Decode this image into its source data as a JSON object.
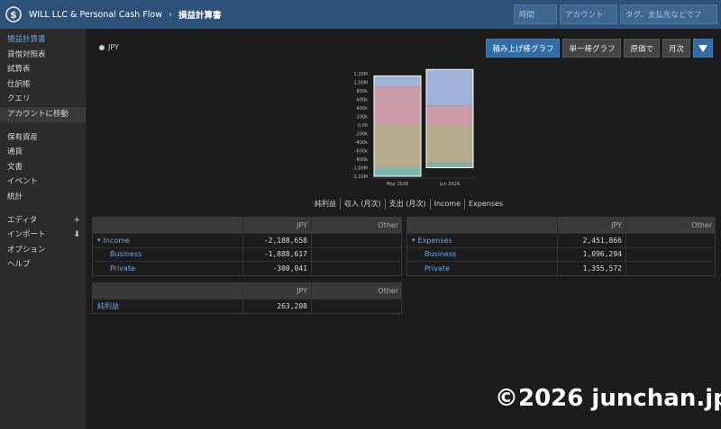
{
  "header": {
    "app_title": "WILL LLC & Personal Cash Flow",
    "separator": "›",
    "page": "損益計算書",
    "inputs": [
      {
        "placeholder": "時間"
      },
      {
        "placeholder": "アカウント"
      },
      {
        "placeholder": "タグ、支払先などでフ"
      }
    ]
  },
  "sidebar": {
    "items": [
      {
        "label": "損益計算書"
      },
      {
        "label": "貸借対照表"
      },
      {
        "label": "試算表"
      },
      {
        "label": "仕訳帳"
      },
      {
        "label": "クエリ"
      },
      {
        "label": "アカウントに移動"
      },
      {
        "label": "保有資産"
      },
      {
        "label": "通貨"
      },
      {
        "label": "文書"
      },
      {
        "label": "イベント"
      },
      {
        "label": "統計"
      },
      {
        "label": "エディタ",
        "action": "+"
      },
      {
        "label": "インポート",
        "action": "⬇"
      },
      {
        "label": "オプション"
      },
      {
        "label": "ヘルプ"
      }
    ]
  },
  "legend": {
    "label": "JPY"
  },
  "toolbar": {
    "stacked": "積み上げ棒グラフ",
    "single": "単一棒グラフ",
    "at_value": "原価で",
    "monthly": "月次"
  },
  "chart_data": {
    "type": "bar",
    "stacked": true,
    "categories": [
      "May 2026",
      "Jun 2026"
    ],
    "y_ticks": [
      "1.20M",
      "1.00M",
      "800k",
      "600k",
      "400k",
      "200k",
      "0.00",
      "-200k",
      "-400k",
      "-600k",
      "-800k",
      "-1.00M",
      "-1.20M"
    ],
    "ylim": [
      -1200000,
      1200000
    ],
    "series": [
      {
        "color": "#c99ba6",
        "values": [
          900000,
          450000
        ]
      },
      {
        "color": "#9fb3d8",
        "values": [
          250000,
          850000
        ]
      },
      {
        "color": "#b3ab8a",
        "values": [
          -1000000,
          -900000
        ]
      },
      {
        "color": "#7db8ae",
        "values": [
          -200000,
          -100000
        ]
      }
    ]
  },
  "tabs": [
    "純利益",
    "収入 (月次)",
    "支出 (月次)",
    "Income",
    "Expenses"
  ],
  "income_table": {
    "head": {
      "jpy": "JPY",
      "other": "Other"
    },
    "rows": [
      {
        "name": "Income",
        "jpy": "-2,188,658",
        "other": "",
        "caret": "▾"
      },
      {
        "name": "Business",
        "jpy": "-1,888,617",
        "other": ""
      },
      {
        "name": "Private",
        "jpy": "-300,041",
        "other": ""
      }
    ]
  },
  "expenses_table": {
    "head": {
      "jpy": "JPY",
      "other": "Other"
    },
    "rows": [
      {
        "name": "Expenses",
        "jpy": "2,451,866",
        "other": "",
        "caret": "▾"
      },
      {
        "name": "Business",
        "jpy": "1,096,294",
        "other": ""
      },
      {
        "name": "Private",
        "jpy": "1,355,572",
        "other": ""
      }
    ]
  },
  "net_table": {
    "head": {
      "jpy": "JPY",
      "other": "Other"
    },
    "rows": [
      {
        "name": "純利益",
        "jpy": "263,208",
        "other": ""
      }
    ]
  },
  "watermark": "©2026 junchan.jp"
}
